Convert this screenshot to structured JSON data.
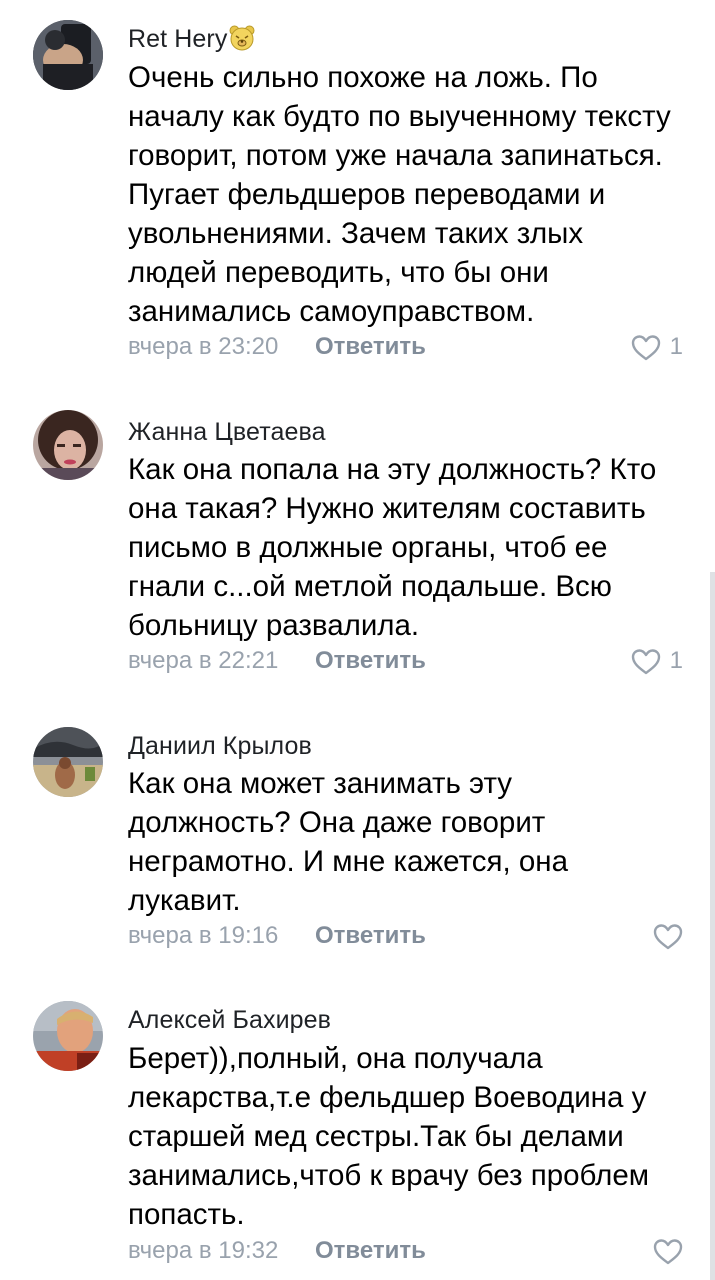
{
  "comments": [
    {
      "author": "Ret Hery",
      "author_badge_icon": "bear-face-emoji",
      "text_lines": [
        "Очень сильно похоже на ложь. По",
        "началу как будто по выученному тексту",
        "говорит, потом уже начала запинаться.",
        "Пугает фельдшеров переводами и",
        "увольнениями. Зачем таких злых",
        "людей переводить, что бы они",
        "занимались самоуправством."
      ],
      "time": "вчера в 23:20",
      "reply_label": "Ответить",
      "likes": "1"
    },
    {
      "author": "Жанна Цветаева",
      "text_lines": [
        "Как она попала на эту должность? Кто",
        "она такая? Нужно жителям составить",
        "письмо в должные органы, чтоб ее",
        "гнали с...ой метлой подальше. Всю",
        "больницу развалила."
      ],
      "time": "вчера в 22:21",
      "reply_label": "Ответить",
      "likes": "1"
    },
    {
      "author": "Даниил Крылов",
      "text_lines": [
        "Как она может занимать эту",
        "должность? Она даже говорит",
        "неграмотно. И мне кажется, она",
        "лукавит."
      ],
      "time": "вчера в 19:16",
      "reply_label": "Ответить",
      "likes": ""
    },
    {
      "author": "Алексей Бахирев",
      "text_lines": [
        "Берет)),полный, она получала",
        "лекарства,т.е фельдшер Воеводина у",
        "старшей мед сестры.Так бы делами",
        "занимались,чтоб к врачу без проблем",
        "попасть."
      ],
      "time": "вчера в 19:32",
      "reply_label": "Ответить",
      "likes": ""
    }
  ],
  "colors": {
    "meta": "#99a2ad",
    "reply": "#818c99",
    "like_icon": "#99a2ad"
  },
  "icons": {
    "like": "heart-outline-icon"
  }
}
